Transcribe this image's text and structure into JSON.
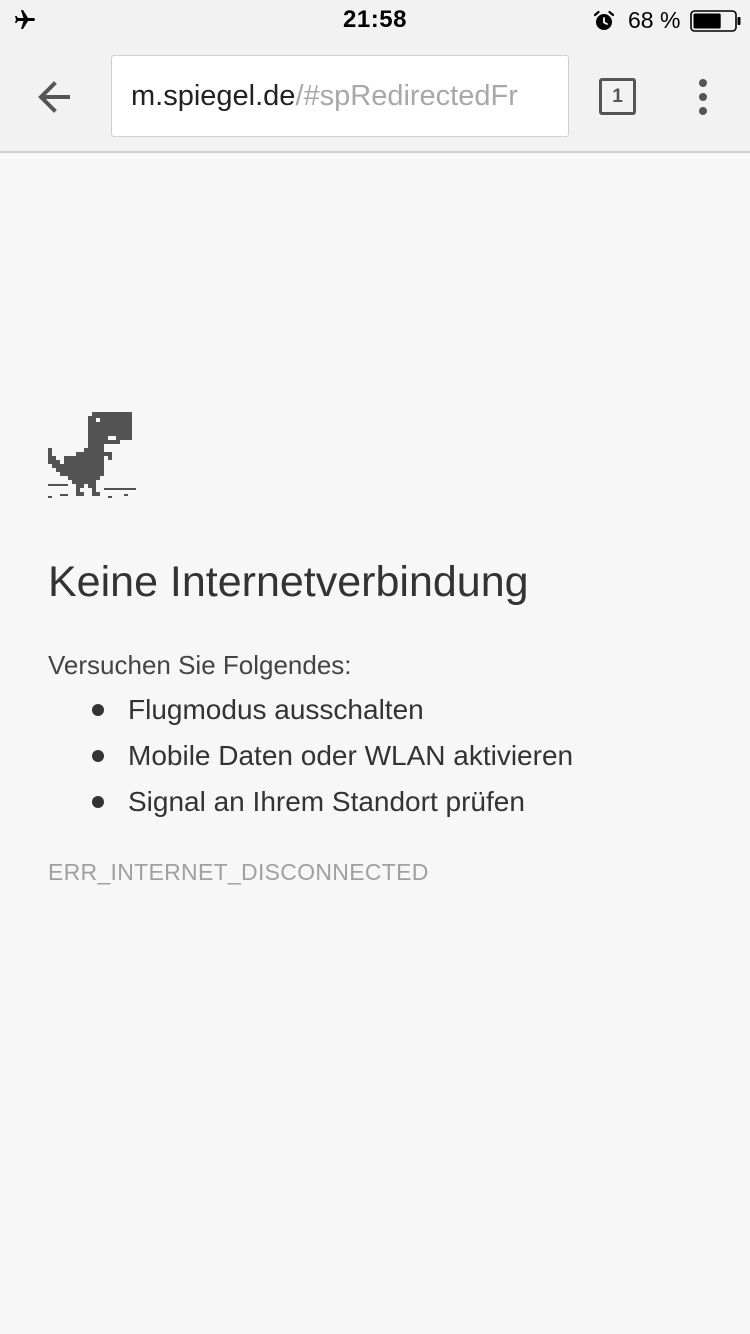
{
  "status_bar": {
    "time": "21:58",
    "battery_percent": "68 %",
    "battery_level": 0.68,
    "icons": [
      "airplane-mode-icon",
      "alarm-icon",
      "battery-icon"
    ]
  },
  "toolbar": {
    "url_host": "m.spiegel.de",
    "url_path": "/#spRedirectedFr",
    "tab_count": "1",
    "icons": [
      "back-arrow-icon",
      "tab-switcher-icon",
      "overflow-menu-icon"
    ]
  },
  "error_page": {
    "headline": "Keine Internetverbindung",
    "intro": "Versuchen Sie Folgendes:",
    "suggestions": [
      "Flugmodus ausschalten",
      "Mobile Daten oder WLAN aktivieren",
      "Signal an Ihrem Standort prüfen"
    ],
    "error_code": "ERR_INTERNET_DISCONNECTED",
    "icon": "offline-dinosaur-icon"
  },
  "colors": {
    "background": "#f7f7f7",
    "toolbar": "#f2f2f2",
    "text": "#333333",
    "muted": "#a0a0a0"
  }
}
